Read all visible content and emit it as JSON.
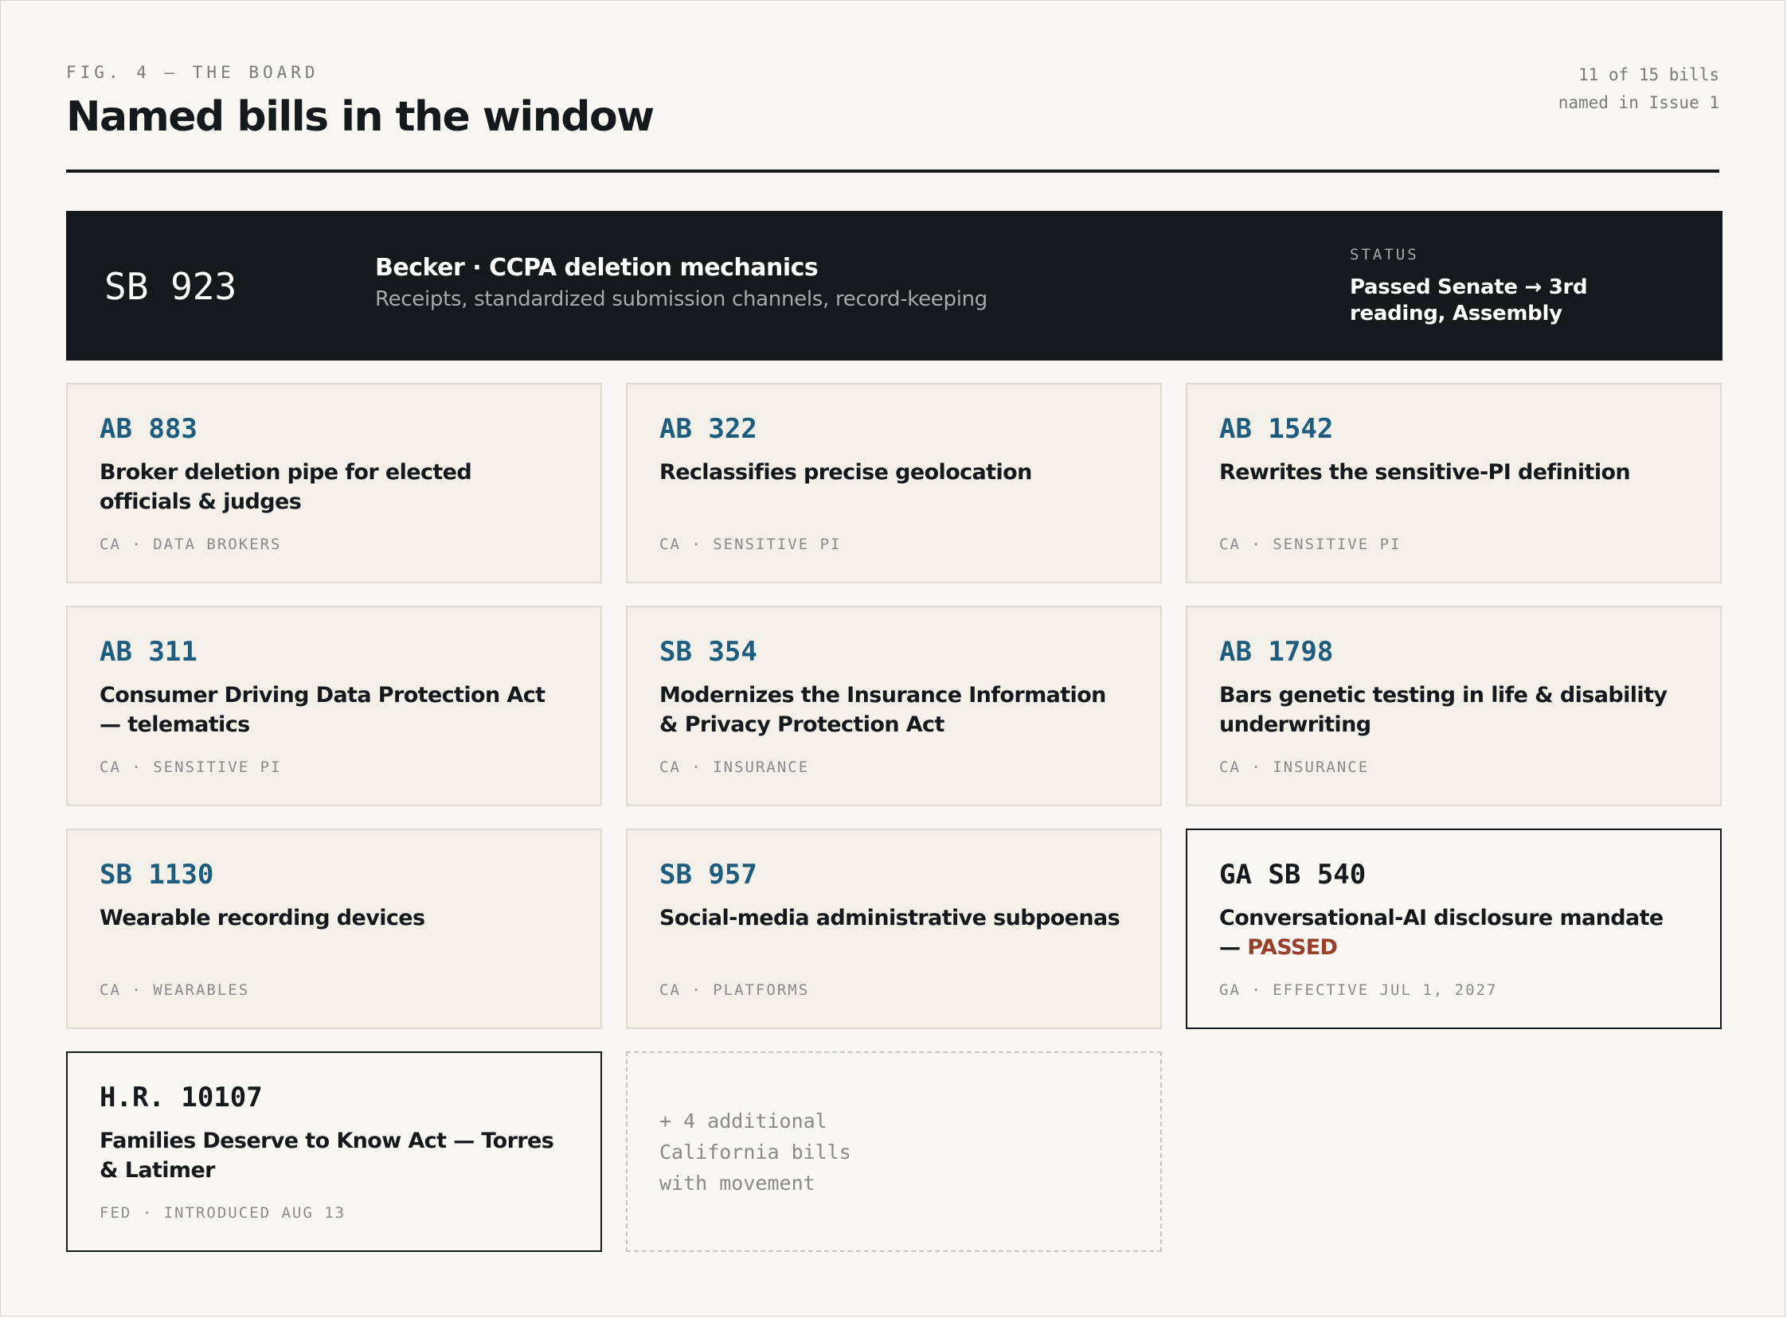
{
  "header": {
    "kicker": "FIG. 4 — THE BOARD",
    "title": "Named bills in the window",
    "count_line1": "11 of 15 bills",
    "count_line2": "named in Issue 1"
  },
  "featured": {
    "id": "SB 923",
    "title": "Becker · CCPA deletion mechanics",
    "subtitle": "Receipts, standardized submission channels, record-keeping",
    "status_label": "STATUS",
    "status_value": "Passed Senate → 3rd reading, Assembly"
  },
  "cards": [
    {
      "id": "AB 883",
      "title": "Broker deletion pipe for elected officials & judges",
      "meta": "CA · DATA BROKERS"
    },
    {
      "id": "AB 322",
      "title": "Reclassifies precise geolocation",
      "meta": "CA · SENSITIVE PI"
    },
    {
      "id": "AB 1542",
      "title": "Rewrites the sensitive-PI definition",
      "meta": "CA · SENSITIVE PI"
    },
    {
      "id": "AB 311",
      "title": "Consumer Driving Data Protection Act — telematics",
      "meta": "CA · SENSITIVE PI"
    },
    {
      "id": "SB 354",
      "title": "Modernizes the Insurance Information & Privacy Protection Act",
      "meta": "CA · INSURANCE"
    },
    {
      "id": "AB 1798",
      "title": "Bars genetic testing in life & disability underwriting",
      "meta": "CA · INSURANCE"
    },
    {
      "id": "SB 1130",
      "title": "Wearable recording devices",
      "meta": "CA · WEARABLES"
    },
    {
      "id": "SB 957",
      "title": "Social-media administrative subpoenas",
      "meta": "CA · PLATFORMS"
    },
    {
      "id": "GA SB 540",
      "title": "Conversational-AI disclosure mandate —",
      "highlight": "PASSED",
      "meta": "GA · EFFECTIVE JUL 1, 2027"
    },
    {
      "id": "H.R. 10107",
      "title": "Families Deserve to Know Act — Torres & Latimer",
      "meta": "FED · INTRODUCED AUG 13"
    }
  ],
  "more": {
    "line1": "+ 4 additional",
    "line2": "California bills",
    "line3": "with movement"
  }
}
